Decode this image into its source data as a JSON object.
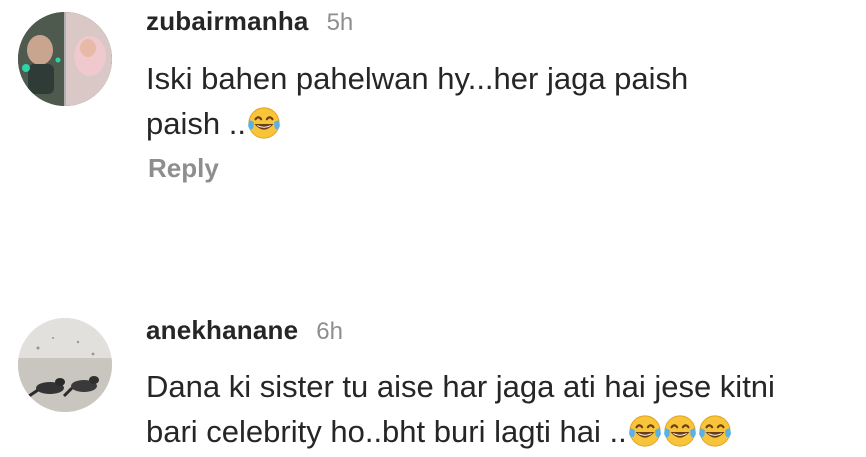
{
  "comments": [
    {
      "username": "zubairmanha",
      "time": "5h",
      "text": "Iski bahen pahelwan hy...her jaga paish\npaish ..",
      "emojis": [
        "face-with-tears-of-joy"
      ],
      "reply_label": "Reply"
    },
    {
      "username": "anekhanane",
      "time": "6h",
      "text": "Dana ki sister tu aise har jaga ati hai jese kitni\nbari celebrity ho..bht buri lagti hai ..",
      "emojis": [
        "face-with-tears-of-joy",
        "face-with-tears-of-joy",
        "face-with-tears-of-joy"
      ]
    }
  ],
  "colors": {
    "primary_text": "#262626",
    "secondary_text": "#8e8e8e",
    "background": "#ffffff"
  }
}
